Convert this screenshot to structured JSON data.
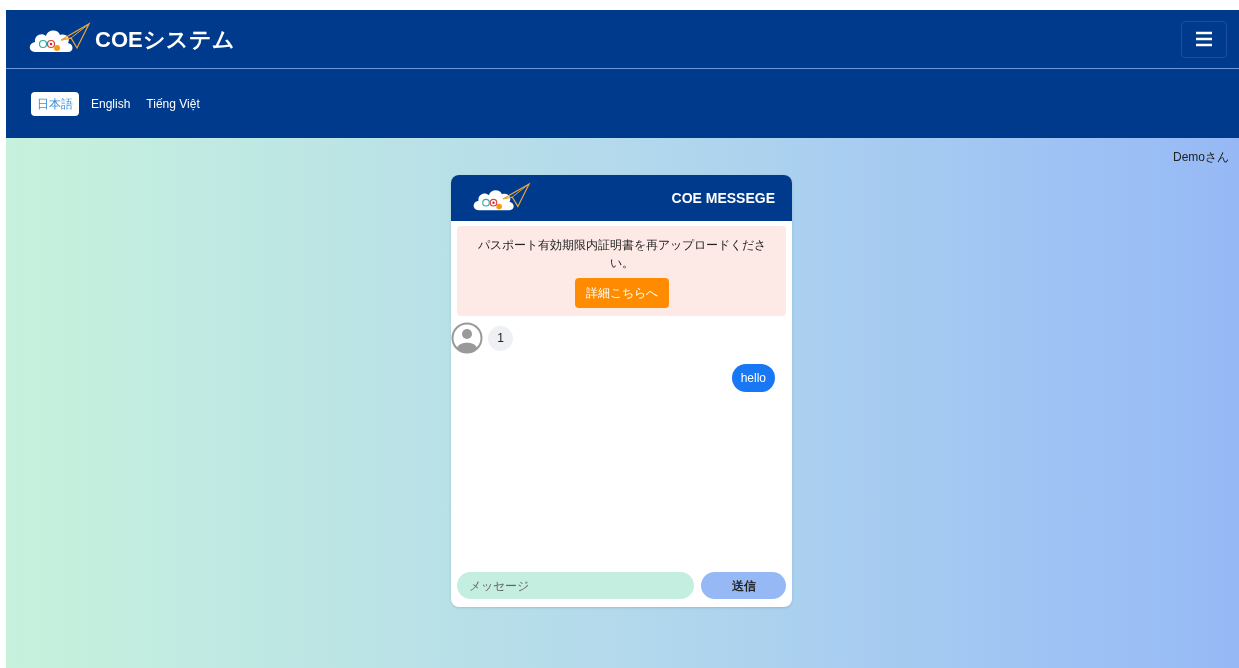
{
  "header": {
    "title": "COEシステム"
  },
  "languages": [
    {
      "label": "日本語",
      "selected": true
    },
    {
      "label": "English",
      "selected": false
    },
    {
      "label": "Tiếng Việt",
      "selected": false
    }
  ],
  "user": {
    "greeting": "Demoさん"
  },
  "chat": {
    "title": "COE MESSEGE",
    "alert": {
      "text": "パスポート有効期限内証明書を再アップロードください。",
      "button": "詳細こちらへ"
    },
    "messages": [
      {
        "kind": "received",
        "text": "1"
      },
      {
        "kind": "sent",
        "text": "hello"
      }
    ],
    "input": {
      "placeholder": "メッセージ"
    },
    "send": "送信"
  }
}
